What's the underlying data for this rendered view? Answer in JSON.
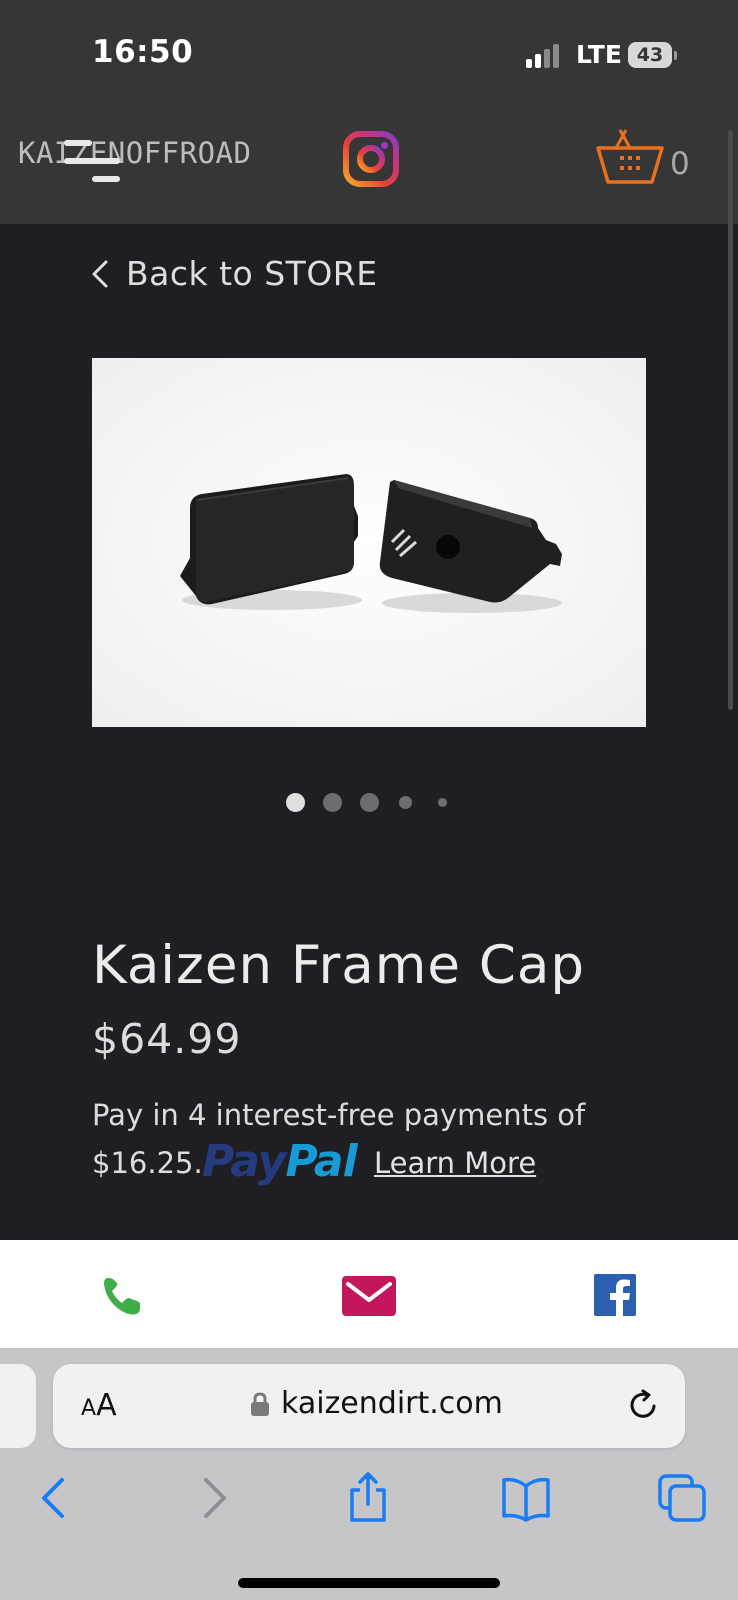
{
  "status_bar": {
    "time": "16:50",
    "network": "LTE",
    "battery": "43"
  },
  "header": {
    "logo": "KAIZENOFFROAD",
    "menu_icon": "hamburger-icon",
    "instagram_icon": "instagram-icon",
    "cart_icon": "shopping-basket-icon",
    "cart_count": "0",
    "cart_color": "#e8701f"
  },
  "nav": {
    "back_label": "Back to STORE"
  },
  "product": {
    "image_alt": "Kaizen Frame Cap product photo",
    "title": "Kaizen Frame Cap",
    "price": "$64.99",
    "paylater_line1": "Pay in 4 interest-free payments of",
    "paylater_amount": "$16.25.",
    "paypal_pay": "Pay",
    "paypal_pal": "Pal",
    "learn_more": "Learn More"
  },
  "carousel": {
    "dot_count": 5,
    "active_index": 0
  },
  "contact": {
    "phone_icon": "phone-icon",
    "email_icon": "email-icon",
    "facebook_icon": "facebook-icon",
    "phone_color": "#3fae49",
    "email_color": "#c2185b",
    "facebook_color": "#2b5faf"
  },
  "browser": {
    "aa_label_small": "A",
    "aa_label_large": "A",
    "url": "kaizendirt.com",
    "accent": "#1a7cf4"
  }
}
